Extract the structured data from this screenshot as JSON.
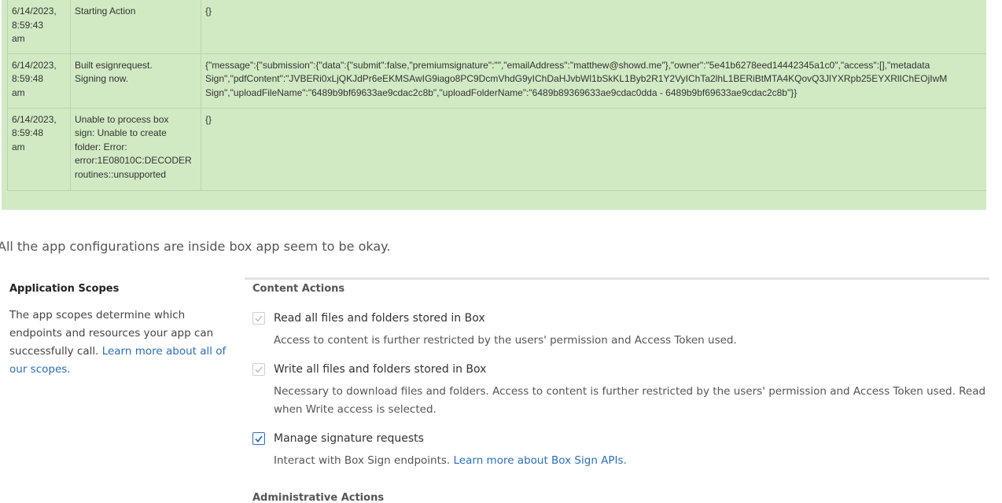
{
  "log": {
    "rows": [
      {
        "date": [
          "6/14/2023,",
          "8:59:43",
          "am"
        ],
        "message": [
          "Starting Action"
        ],
        "data": [
          "{}"
        ]
      },
      {
        "date": [
          "6/14/2023,",
          "8:59:48",
          "am"
        ],
        "message": [
          "Built esignrequest.",
          "Signing now."
        ],
        "data": [
          "{\"message\":{\"submission\":{\"data\":{\"submit\":false,\"premiumsignature\":\"\",\"emailAddress\":\"matthew@showd.me\"},\"owner\":\"5e41b6278eed14442345a1c0\",\"access\":[],\"metadata",
          "Sign\",\"pdfContent\":\"JVBERi0xLjQKJdPr6eEKMSAwIG9iago8PC9DcmVhdG9yIChDaHJvbWl1bSkKL1Byb2R1Y2VyIChTa2lhL1BERiBtMTA4KQovQ3JlYXRpb25EYXRlIChEOjIwM",
          "Sign\",\"uploadFileName\":\"6489b9bf69633ae9cdac2c8b\",\"uploadFolderName\":\"6489b89369633ae9cdac0dda - 6489b9bf69633ae9cdac2c8b\"}}"
        ]
      },
      {
        "date": [
          "6/14/2023,",
          "8:59:48",
          "am"
        ],
        "message": [
          "Unable to process box",
          "sign: Unable to create",
          "folder: Error:",
          "error:1E08010C:DECODER",
          "routines::unsupported"
        ],
        "data": [
          "{}"
        ]
      }
    ]
  },
  "forum": {
    "text": "All the app configurations are inside box app seem to be okay."
  },
  "scopes": {
    "heading": "Application Scopes",
    "description": "The app scopes determine which endpoints and resources your app can successfully call.",
    "learn_more_link": "Learn more about all of our scopes.",
    "content_actions_title": "Content Actions",
    "read": {
      "label": "Read all files and folders stored in Box",
      "desc": "Access to content is further restricted by the users' permission and Access Token used.",
      "checked": true
    },
    "write": {
      "label": "Write all files and folders stored in Box",
      "desc": "Necessary to download files and folders. Access to content is further restricted by the users' permission and Access Token used. Read when Write access is selected.",
      "checked": true
    },
    "sign": {
      "label": "Manage signature requests",
      "desc": "Interact with Box Sign endpoints.",
      "link": "Learn more about Box Sign APIs.",
      "checked": true
    },
    "admin_actions_title": "Administrative Actions"
  },
  "colors": {
    "log_background": "#d1eac4",
    "link": "#2b6fb6",
    "checkbox_enabled": "#2b6fb6",
    "checkbox_disabled": "#b8b8b8"
  }
}
